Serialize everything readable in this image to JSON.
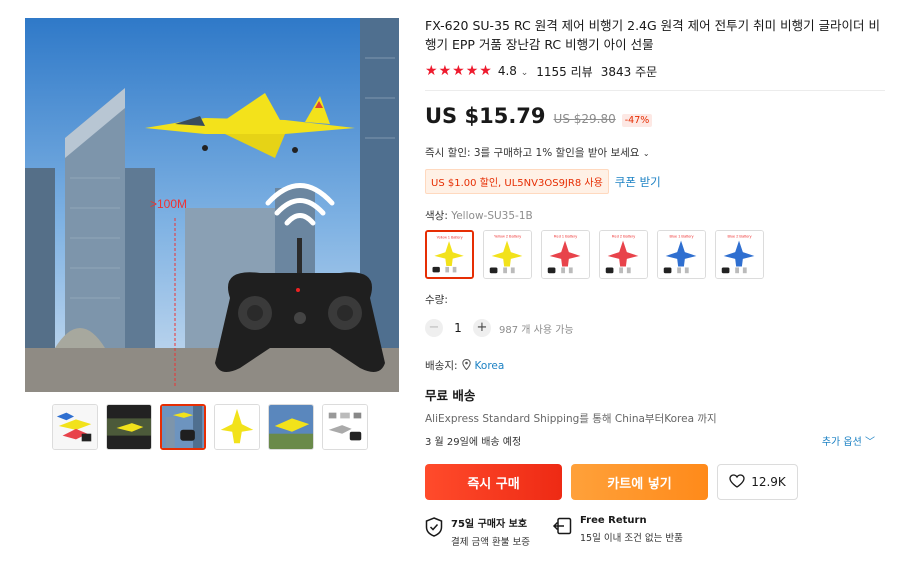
{
  "product": {
    "title": "FX-620 SU-35 RC 원격 제어 비행기 2.4G 원격 제어 전투기 취미 비행기 글라이더 비행기 EPP 거품 장난감 RC 비행기 아이 선물",
    "rating": "4.8",
    "reviews": "1155 리뷰",
    "orders": "3843 주문"
  },
  "gallery": {
    "main_overlay_text": ">100M",
    "thumbnails": [
      "Overview",
      "Flying",
      "Controller",
      "Yellow jet",
      "Jet in flight",
      "Package contents"
    ],
    "active_index": 2
  },
  "price": {
    "current": "US $15.79",
    "original": "US $29.80",
    "discount": "-47%"
  },
  "promo": {
    "instant_discount": "즉시 할인: 3를 구매하고 1% 할인을 받아 보세요",
    "coupon": "US $1.00 할인, UL5NV3OS9JR8 사용",
    "coupon_link": "쿠폰 받기"
  },
  "color": {
    "label": "색상:",
    "selected": "Yellow-SU35-1B",
    "options": [
      {
        "tag": "Yellow 1 Battery",
        "color": "#f2e21b"
      },
      {
        "tag": "Yellow 2 Battery",
        "color": "#f2e21b"
      },
      {
        "tag": "Red 1 Battery",
        "color": "#e8434b"
      },
      {
        "tag": "Red 2 Battery",
        "color": "#e8434b"
      },
      {
        "tag": "Blue 1 Battery",
        "color": "#2f6fd0"
      },
      {
        "tag": "Blue 2 Battery",
        "color": "#2f6fd0"
      }
    ]
  },
  "quantity": {
    "label": "수량:",
    "value": "1",
    "stock": "987 개 사용 가능"
  },
  "shipping": {
    "ship_to_label": "배송지:",
    "country": "Korea",
    "free_shipping": "무료 배송",
    "method": "AliExpress Standard Shipping를 통해 China부터Korea 까지",
    "eta": "3 월 29일에 배송 예정",
    "more_options": "추가 옵션"
  },
  "actions": {
    "buy_now": "즉시 구매",
    "add_to_cart": "카트에 넣기",
    "wishlist_count": "12.9K"
  },
  "guarantees": [
    {
      "title": "75일 구매자 보호",
      "subtitle": "결제 금액 환불 보증"
    },
    {
      "title": "Free Return",
      "subtitle": "15일 이내 조건 없는 반품"
    }
  ],
  "colors": {
    "accent_red": "#e62e04",
    "link_blue": "#1d82c4",
    "star_red": "#ee1b2e",
    "cart_orange": "#ff8a1a"
  }
}
